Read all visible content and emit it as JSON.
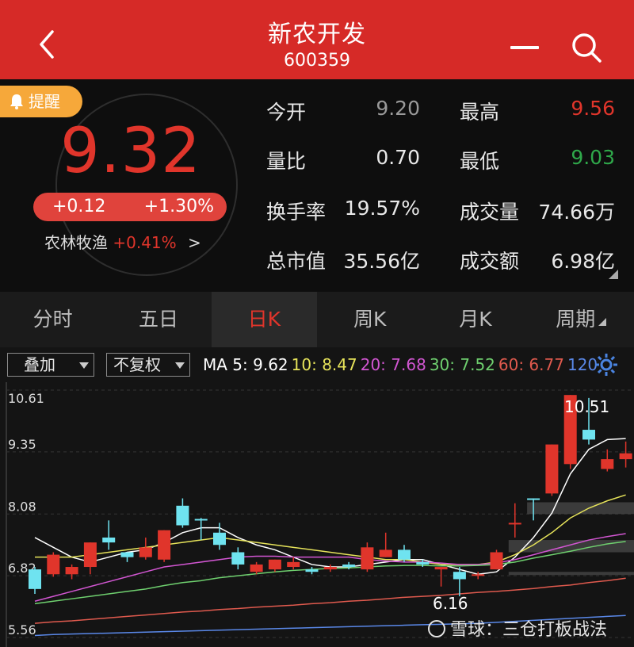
{
  "header": {
    "title": "新农开发",
    "code": "600359"
  },
  "quote": {
    "alert_label": "提醒",
    "price": "9.32",
    "change": "+0.12",
    "change_pct": "+1.30%",
    "sector": {
      "name": "农林牧渔",
      "pct": "+0.41%",
      "arrow": ">"
    },
    "stats": [
      {
        "label": "今开",
        "value": "9.20",
        "color": "#9a9a9a"
      },
      {
        "label": "最高",
        "value": "9.56",
        "color": "#e0352b"
      },
      {
        "label": "量比",
        "value": "0.70",
        "color": "#e8e8e8"
      },
      {
        "label": "最低",
        "value": "9.03",
        "color": "#2fa84a"
      },
      {
        "label": "换手率",
        "value": "19.57%",
        "color": "#e8e8e8"
      },
      {
        "label": "成交量",
        "value": "74.66万",
        "color": "#e8e8e8"
      },
      {
        "label": "总市值",
        "value": "35.56亿",
        "color": "#e8e8e8"
      },
      {
        "label": "成交额",
        "value": "6.98亿",
        "color": "#e8e8e8"
      }
    ]
  },
  "tabs": [
    {
      "label": "分时",
      "active": false
    },
    {
      "label": "五日",
      "active": false
    },
    {
      "label": "日K",
      "active": true
    },
    {
      "label": "周K",
      "active": false
    },
    {
      "label": "月K",
      "active": false
    },
    {
      "label": "周期",
      "active": false
    }
  ],
  "toolbar": {
    "overlay_select": "叠加",
    "adjust_select": "不复权",
    "ma": [
      {
        "text": "MA 5: 9.62",
        "color": "#ffffff"
      },
      {
        "text": "10: 8.47",
        "color": "#e6e35a"
      },
      {
        "text": "20: 7.68",
        "color": "#d256d2"
      },
      {
        "text": "30: 7.52",
        "color": "#6fd06f"
      },
      {
        "text": "60: 6.77",
        "color": "#e05a4e"
      },
      {
        "text": "120",
        "color": "#5a88e8"
      }
    ]
  },
  "chart_data": {
    "type": "candlestick",
    "y_labels": [
      "10.61",
      "9.35",
      "8.08",
      "6.82",
      "5.56"
    ],
    "ylim": [
      5.56,
      10.61
    ],
    "high_label": "10.51",
    "low_label": "6.16",
    "candles": [
      {
        "o": 6.55,
        "c": 6.95,
        "h": 7.0,
        "l": 6.45,
        "up": true
      },
      {
        "o": 7.25,
        "c": 6.85,
        "h": 7.3,
        "l": 6.8,
        "up": false
      },
      {
        "o": 7.0,
        "c": 6.85,
        "h": 7.05,
        "l": 6.75,
        "up": false
      },
      {
        "o": 7.5,
        "c": 7.0,
        "h": 7.5,
        "l": 6.85,
        "up": false
      },
      {
        "o": 7.5,
        "c": 7.6,
        "h": 7.95,
        "l": 7.35,
        "up": true
      },
      {
        "o": 7.2,
        "c": 7.3,
        "h": 7.3,
        "l": 7.1,
        "up": true
      },
      {
        "o": 7.4,
        "c": 7.2,
        "h": 7.6,
        "l": 7.15,
        "up": false
      },
      {
        "o": 7.15,
        "c": 7.75,
        "h": 7.75,
        "l": 7.1,
        "up": false
      },
      {
        "o": 7.85,
        "c": 8.25,
        "h": 8.4,
        "l": 7.8,
        "up": true
      },
      {
        "o": 7.95,
        "c": 7.98,
        "h": 8.0,
        "l": 7.55,
        "up": true
      },
      {
        "o": 7.45,
        "c": 7.7,
        "h": 7.9,
        "l": 7.35,
        "up": true
      },
      {
        "o": 7.05,
        "c": 7.3,
        "h": 7.4,
        "l": 6.95,
        "up": true
      },
      {
        "o": 7.05,
        "c": 6.9,
        "h": 7.1,
        "l": 6.85,
        "up": false
      },
      {
        "o": 7.15,
        "c": 6.95,
        "h": 7.15,
        "l": 6.9,
        "up": false
      },
      {
        "o": 7.1,
        "c": 7.0,
        "h": 7.2,
        "l": 6.95,
        "up": false
      },
      {
        "o": 6.95,
        "c": 6.9,
        "h": 7.0,
        "l": 6.85,
        "up": true
      },
      {
        "o": 7.0,
        "c": 6.95,
        "h": 7.05,
        "l": 6.9,
        "up": false
      },
      {
        "o": 7.05,
        "c": 7.0,
        "h": 7.1,
        "l": 6.95,
        "up": true
      },
      {
        "o": 6.95,
        "c": 7.4,
        "h": 7.5,
        "l": 6.9,
        "up": false
      },
      {
        "o": 7.2,
        "c": 7.35,
        "h": 7.7,
        "l": 7.2,
        "up": false
      },
      {
        "o": 7.35,
        "c": 7.15,
        "h": 7.45,
        "l": 7.1,
        "up": true
      },
      {
        "o": 7.1,
        "c": 7.05,
        "h": 7.15,
        "l": 7.0,
        "up": true
      },
      {
        "o": 7.0,
        "c": 6.95,
        "h": 7.0,
        "l": 6.6,
        "up": false
      },
      {
        "o": 6.9,
        "c": 6.75,
        "h": 7.0,
        "l": 6.4,
        "up": true
      },
      {
        "o": 6.82,
        "c": 6.85,
        "h": 6.9,
        "l": 6.75,
        "up": false
      },
      {
        "o": 6.95,
        "c": 7.3,
        "h": 7.35,
        "l": 6.95,
        "up": false
      },
      {
        "o": 7.9,
        "c": 7.9,
        "h": 8.3,
        "l": 7.6,
        "up": false
      },
      {
        "o": 8.4,
        "c": 8.4,
        "h": 8.4,
        "l": 7.95,
        "up": true
      },
      {
        "o": 8.5,
        "c": 9.5,
        "h": 9.5,
        "l": 8.45,
        "up": false
      },
      {
        "o": 9.1,
        "c": 10.51,
        "h": 10.51,
        "l": 9.0,
        "up": false
      },
      {
        "o": 9.8,
        "c": 9.6,
        "h": 10.45,
        "l": 9.5,
        "up": true
      },
      {
        "o": 9.0,
        "c": 9.2,
        "h": 9.4,
        "l": 8.95,
        "up": false
      },
      {
        "o": 9.2,
        "c": 9.32,
        "h": 9.56,
        "l": 9.03,
        "up": false
      }
    ],
    "ma_lines": [
      {
        "name": "MA5",
        "color": "#ffffff",
        "values": [
          7.6,
          7.4,
          7.2,
          7.1,
          7.2,
          7.3,
          7.35,
          7.5,
          7.7,
          7.8,
          7.8,
          7.6,
          7.45,
          7.35,
          7.2,
          7.05,
          7.0,
          7.0,
          7.05,
          7.1,
          7.15,
          7.15,
          7.05,
          6.95,
          6.85,
          6.9,
          7.2,
          7.6,
          8.1,
          8.9,
          9.4,
          9.6,
          9.62
        ]
      },
      {
        "name": "MA10",
        "color": "#e6e35a",
        "values": [
          7.2,
          7.2,
          7.2,
          7.25,
          7.3,
          7.35,
          7.4,
          7.45,
          7.5,
          7.55,
          7.6,
          7.55,
          7.5,
          7.45,
          7.4,
          7.35,
          7.3,
          7.25,
          7.2,
          7.15,
          7.15,
          7.1,
          7.05,
          7.05,
          7.05,
          7.1,
          7.25,
          7.45,
          7.7,
          8.0,
          8.2,
          8.35,
          8.47
        ]
      },
      {
        "name": "MA20",
        "color": "#d256d2",
        "values": [
          6.3,
          6.4,
          6.5,
          6.6,
          6.7,
          6.8,
          6.9,
          7.0,
          7.05,
          7.1,
          7.15,
          7.2,
          7.22,
          7.22,
          7.2,
          7.2,
          7.2,
          7.2,
          7.15,
          7.12,
          7.1,
          7.1,
          7.08,
          7.05,
          7.05,
          7.08,
          7.15,
          7.25,
          7.35,
          7.45,
          7.55,
          7.62,
          7.68
        ]
      },
      {
        "name": "MA30",
        "color": "#6fd06f",
        "values": [
          6.25,
          6.3,
          6.35,
          6.4,
          6.45,
          6.5,
          6.55,
          6.62,
          6.68,
          6.72,
          6.78,
          6.82,
          6.86,
          6.9,
          6.93,
          6.95,
          6.97,
          6.98,
          7.0,
          7.02,
          7.03,
          7.03,
          7.02,
          7.02,
          7.03,
          7.05,
          7.1,
          7.18,
          7.25,
          7.32,
          7.4,
          7.47,
          7.52
        ]
      },
      {
        "name": "MA60",
        "color": "#e05a4e",
        "values": [
          5.85,
          5.88,
          5.9,
          5.93,
          5.96,
          5.99,
          6.02,
          6.05,
          6.08,
          6.1,
          6.13,
          6.15,
          6.18,
          6.2,
          6.22,
          6.25,
          6.27,
          6.3,
          6.32,
          6.35,
          6.38,
          6.4,
          6.42,
          6.45,
          6.48,
          6.5,
          6.53,
          6.56,
          6.6,
          6.63,
          6.68,
          6.72,
          6.77
        ]
      },
      {
        "name": "MA120",
        "color": "#5a88e8",
        "values": [
          5.6,
          5.62,
          5.63,
          5.64,
          5.65,
          5.66,
          5.67,
          5.68,
          5.69,
          5.7,
          5.71,
          5.72,
          5.73,
          5.74,
          5.75,
          5.76,
          5.77,
          5.78,
          5.79,
          5.8,
          5.81,
          5.82,
          5.83,
          5.84,
          5.85,
          5.87,
          5.89,
          5.91,
          5.93,
          5.95,
          5.97,
          5.99,
          6.01
        ]
      }
    ],
    "volume_profile": [
      {
        "lo": 8.08,
        "hi": 8.32,
        "from": 27
      },
      {
        "lo": 7.3,
        "hi": 7.55,
        "from": 26
      },
      {
        "lo": 6.85,
        "hi": 6.9,
        "from": 26
      }
    ]
  },
  "watermark": "雪球：三仓打板战法",
  "colors": {
    "header": "#d62a27",
    "up": "#e0352b",
    "down": "#6fe3f0",
    "accent": "#f6a83a"
  }
}
